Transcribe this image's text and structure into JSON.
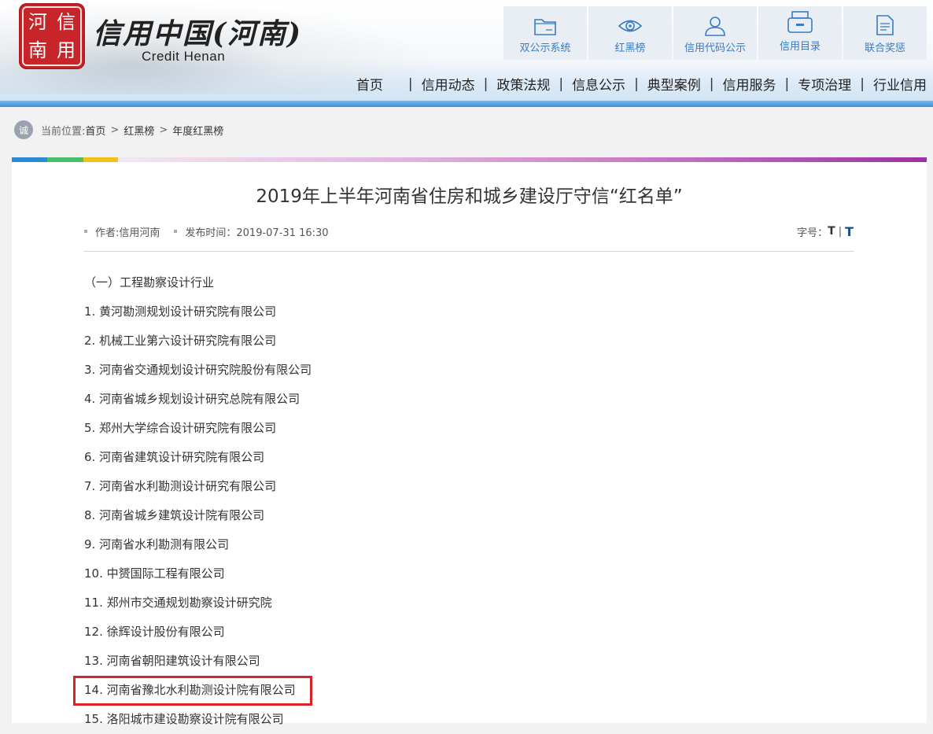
{
  "header": {
    "seal_chars": [
      "河",
      "信",
      "南",
      "用"
    ],
    "brand_cn": "信用中国(河南)",
    "brand_en": "Credit Henan",
    "quick_links": [
      {
        "label": "双公示系统",
        "icon": "folder-icon"
      },
      {
        "label": "红黑榜",
        "icon": "eye-icon"
      },
      {
        "label": "信用代码公示",
        "icon": "user-icon"
      },
      {
        "label": "信用目录",
        "icon": "printer-icon"
      },
      {
        "label": "联合奖惩",
        "icon": "document-icon"
      }
    ],
    "nav": [
      "首页",
      "信用动态",
      "政策法规",
      "信息公示",
      "典型案例",
      "信用服务",
      "专项治理",
      "行业信用"
    ]
  },
  "breadcrumb": {
    "prefix": "当前位置:",
    "items": [
      "首页",
      "红黑榜",
      "年度红黑榜"
    ],
    "icon_char": "诚"
  },
  "article": {
    "title": "2019年上半年河南省住房和城乡建设厅守信“红名单”",
    "author": "作者:信用河南",
    "published": "发布时间：2019-07-31 16:30",
    "font_size_label": "字号：",
    "font_small": "T",
    "font_large": "T",
    "lines": [
      "（一）工程勘察设计行业",
      "1. 黄河勘测规划设计研究院有限公司",
      "2. 机械工业第六设计研究院有限公司",
      "3. 河南省交通规划设计研究院股份有限公司",
      "4. 河南省城乡规划设计研究总院有限公司",
      "5. 郑州大学综合设计研究院有限公司",
      "6. 河南省建筑设计研究院有限公司",
      "7. 河南省水利勘测设计研究有限公司",
      "8. 河南省城乡建筑设计院有限公司",
      "9. 河南省水利勘测有限公司",
      "10. 中赟国际工程有限公司",
      "11. 郑州市交通规划勘察设计研究院",
      "12. 徐辉设计股份有限公司",
      "13. 河南省朝阳建筑设计有限公司",
      "14. 河南省豫北水利勘测设计院有限公司",
      "15. 洛阳城市建设勘察设计院有限公司"
    ]
  },
  "colors": {
    "accent_blue": "#3a7cc3",
    "seal_red": "#c8252a",
    "highlight_red": "#d8232a"
  }
}
